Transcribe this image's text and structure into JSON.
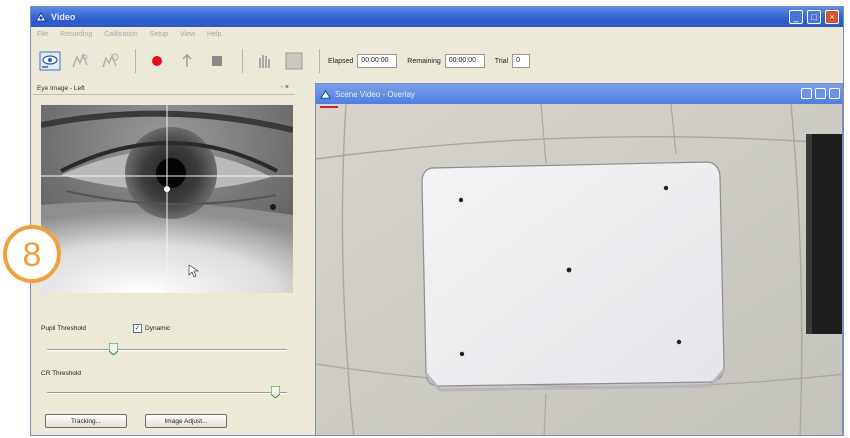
{
  "app": {
    "title": "Video"
  },
  "menu": [
    "File",
    "Recording",
    "Calibration",
    "Setup",
    "View",
    "Help"
  ],
  "toolbar": {
    "elapsed_label": "Elapsed",
    "elapsed_value": "00:00:00",
    "remaining_label": "Remaining",
    "remaining_value": "00:00:00",
    "trial_label": "Trial",
    "trial_value": "0"
  },
  "eye_panel": {
    "header": "Eye Image - Left",
    "pupil_threshold_label": "Pupil Threshold",
    "dynamic_label": "Dynamic",
    "dynamic_checked": true,
    "pupil_threshold_level": 0.27,
    "cr_threshold_label": "CR Threshold",
    "cr_threshold_level": 0.97,
    "tracking_button": "Tracking...",
    "image_adjust_button": "Image Adjust..."
  },
  "scene_window": {
    "title": "Scene Video - Overlay"
  },
  "badge": {
    "number": "8",
    "color": "#f0a040"
  },
  "colors": {
    "titlebar": "#2f5fcf",
    "record": "#e0101a",
    "close": "#d9542b"
  }
}
